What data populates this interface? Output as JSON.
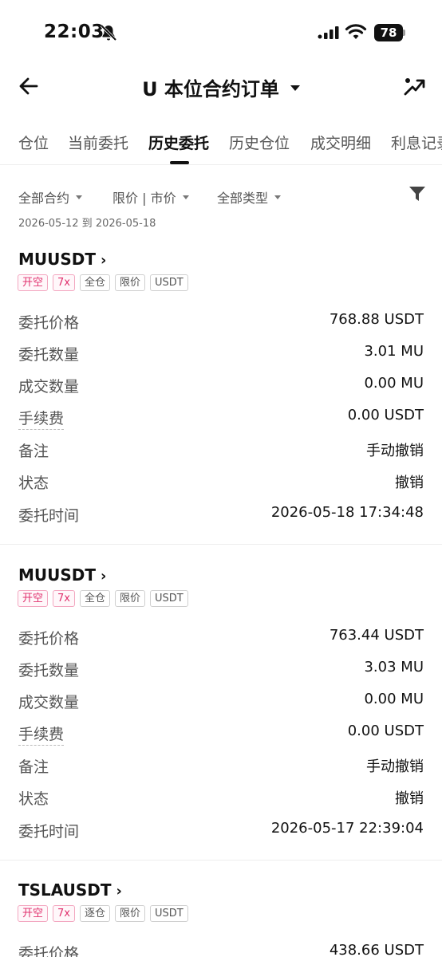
{
  "status_bar": {
    "time": "22:03",
    "battery": "78"
  },
  "header": {
    "title": "U 本位合约订单"
  },
  "tabs": [
    {
      "label": "仓位"
    },
    {
      "label": "当前委托"
    },
    {
      "label": "历史委托"
    },
    {
      "label": "历史仓位"
    },
    {
      "label": "成交明细"
    },
    {
      "label": "利息记录"
    }
  ],
  "active_tab": "历史委托",
  "filters": [
    {
      "label": "全部合约"
    },
    {
      "label": "限价 | 市价"
    },
    {
      "label": "全部类型"
    }
  ],
  "date_range": "2026-05-12 到 2026-05-18",
  "orders": [
    {
      "symbol": "MUUSDT",
      "tags": [
        "开空",
        "7x",
        "全仓",
        "限价",
        "USDT"
      ],
      "rows": [
        {
          "label": "委托价格",
          "value": "768.88 USDT"
        },
        {
          "label": "委托数量",
          "value": "3.01 MU"
        },
        {
          "label": "成交数量",
          "value": "0.00 MU"
        },
        {
          "label": "手续费",
          "value": "0.00 USDT"
        },
        {
          "label": "备注",
          "value": "手动撤销"
        },
        {
          "label": "状态",
          "value": "撤销"
        },
        {
          "label": "委托时间",
          "value": "2026-05-18 17:34:48"
        }
      ]
    },
    {
      "symbol": "MUUSDT",
      "tags": [
        "开空",
        "7x",
        "全仓",
        "限价",
        "USDT"
      ],
      "rows": [
        {
          "label": "委托价格",
          "value": "763.44 USDT"
        },
        {
          "label": "委托数量",
          "value": "3.03 MU"
        },
        {
          "label": "成交数量",
          "value": "0.00 MU"
        },
        {
          "label": "手续费",
          "value": "0.00 USDT"
        },
        {
          "label": "备注",
          "value": "手动撤销"
        },
        {
          "label": "状态",
          "value": "撤销"
        },
        {
          "label": "委托时间",
          "value": "2026-05-17 22:39:04"
        }
      ]
    },
    {
      "symbol": "TSLAUSDT",
      "tags": [
        "开空",
        "7x",
        "逐仓",
        "限价",
        "USDT"
      ],
      "rows": [
        {
          "label": "委托价格",
          "value": "438.66 USDT"
        }
      ]
    }
  ],
  "colors": {
    "accent_pink": "#e0306d",
    "text": "#111111",
    "muted": "#555555"
  }
}
